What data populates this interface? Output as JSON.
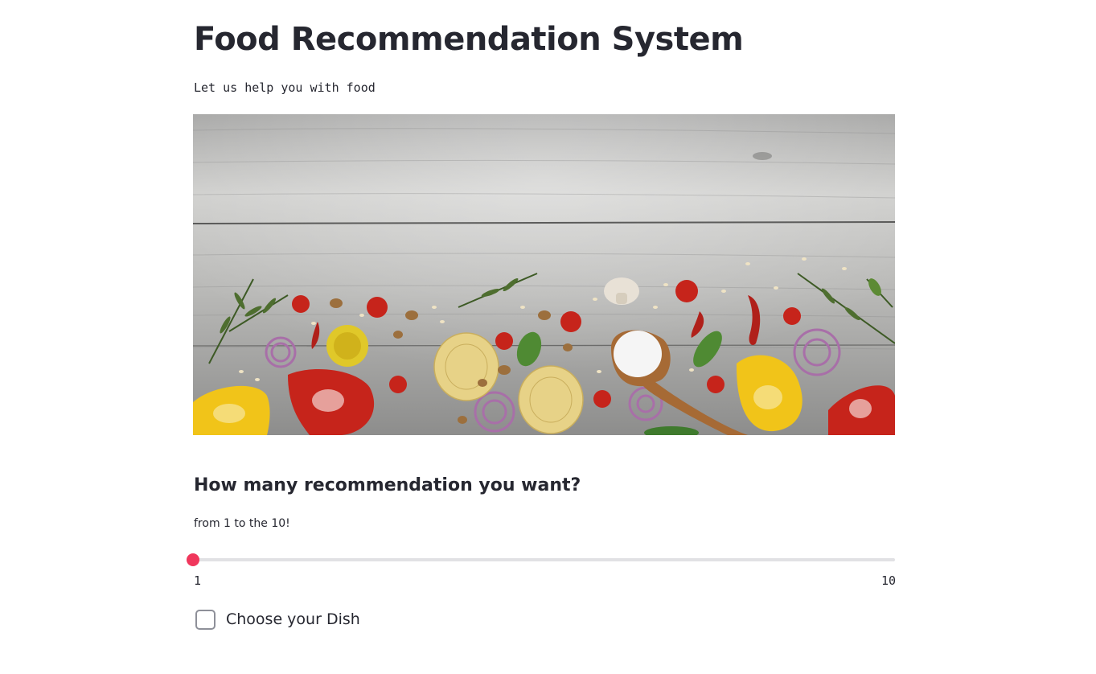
{
  "header": {
    "title": "Food Recommendation System",
    "subtitle": "Let us help you with food"
  },
  "hero_image": {
    "description_icon": "food-ingredients-banner-image"
  },
  "recommendations": {
    "heading": "How many recommendation you want?",
    "caption": "from 1 to the 10!",
    "slider": {
      "min_label": "1",
      "max_label": "10",
      "min": 1,
      "max": 10,
      "value": 1
    }
  },
  "dish_checkbox": {
    "label": "Choose your Dish",
    "checked": false
  },
  "colors": {
    "accent": "#f0375c",
    "text": "#262730",
    "track": "#e1e1e4"
  }
}
